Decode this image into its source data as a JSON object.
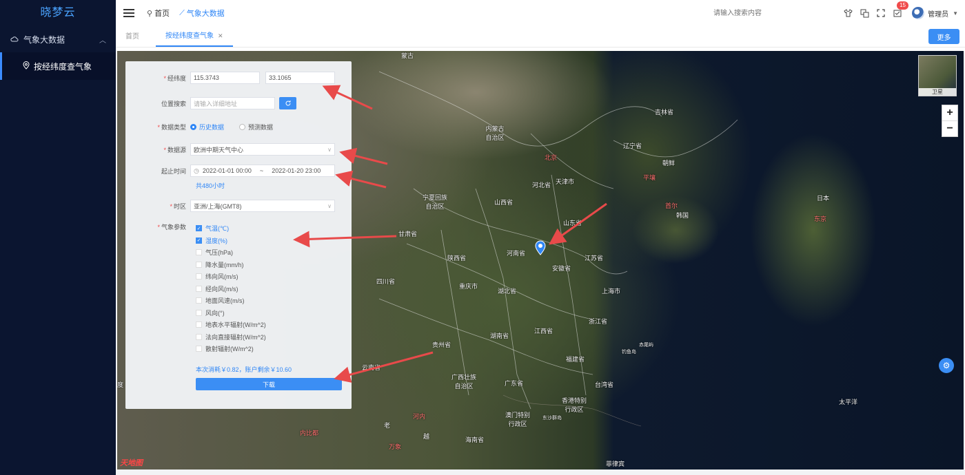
{
  "sidebar": {
    "logo": "晓梦云",
    "group_label": "气象大数据",
    "active_item": "按经纬度查气象"
  },
  "header": {
    "crumb_home": "首页",
    "crumb_current": "气象大数据",
    "search_placeholder": "请输入搜索内容",
    "notification_count": "15",
    "user_name": "管理员"
  },
  "tabs": {
    "home": "首页",
    "active": "按经纬度查气象",
    "more_button": "更多"
  },
  "form": {
    "latlng_label": "经纬度",
    "lng_value": "115.3743",
    "lat_value": "33.1065",
    "location_label": "位置搜索",
    "location_placeholder": "请输入详细地址",
    "datatype_label": "数据类型",
    "datatype_options": [
      "历史数据",
      "预测数据"
    ],
    "datatype_selected": "历史数据",
    "source_label": "数据源",
    "source_value": "欧洲中期天气中心",
    "time_label": "起止时间",
    "time_start": "2022-01-01 00:00",
    "time_sep": "~",
    "time_end": "2022-01-20 23:00",
    "total_hours": "共480小时",
    "tz_label": "时区",
    "tz_value": "亚洲/上海(GMT8)",
    "params_label": "气象参数",
    "params": [
      {
        "label": "气温(℃)",
        "checked": true
      },
      {
        "label": "湿度(%)",
        "checked": true
      },
      {
        "label": "气压(hPa)",
        "checked": false
      },
      {
        "label": "降水量(mm/h)",
        "checked": false
      },
      {
        "label": "纬向风(m/s)",
        "checked": false
      },
      {
        "label": "经向风(m/s)",
        "checked": false
      },
      {
        "label": "地面风速(m/s)",
        "checked": false
      },
      {
        "label": "风向(°)",
        "checked": false
      },
      {
        "label": "地表水平辐射(W/m^2)",
        "checked": false
      },
      {
        "label": "法向直接辐射(W/m^2)",
        "checked": false
      },
      {
        "label": "散射辐射(W/m^2)",
        "checked": false
      }
    ],
    "cost_text": "本次消耗￥0.82，账户剩余￥10.60",
    "download_button": "下载"
  },
  "map": {
    "layer_label": "卫星",
    "watermark": "天地图",
    "labels": [
      {
        "text": "蒙古",
        "red": false
      },
      {
        "text": "内蒙古自治区",
        "red": false
      },
      {
        "text": "北京",
        "red": true
      },
      {
        "text": "天津市",
        "red": false
      },
      {
        "text": "河北省",
        "red": false
      },
      {
        "text": "山西省",
        "red": false
      },
      {
        "text": "宁夏回族自治区",
        "red": false
      },
      {
        "text": "甘肃省",
        "red": false
      },
      {
        "text": "陕西省",
        "red": false
      },
      {
        "text": "河南省",
        "red": false
      },
      {
        "text": "山东省",
        "red": false
      },
      {
        "text": "江苏省",
        "red": false
      },
      {
        "text": "安徽省",
        "red": false
      },
      {
        "text": "上海市",
        "red": false
      },
      {
        "text": "四川省",
        "red": false
      },
      {
        "text": "重庆市",
        "red": false
      },
      {
        "text": "湖北省",
        "red": false
      },
      {
        "text": "湖南省",
        "red": false
      },
      {
        "text": "江西省",
        "red": false
      },
      {
        "text": "浙江省",
        "red": false
      },
      {
        "text": "福建省",
        "red": false
      },
      {
        "text": "贵州省",
        "red": false
      },
      {
        "text": "云南省",
        "red": false
      },
      {
        "text": "广西壮族自治区",
        "red": false
      },
      {
        "text": "广东省",
        "red": false
      },
      {
        "text": "台湾省",
        "red": false
      },
      {
        "text": "海南省",
        "red": false
      },
      {
        "text": "香港特别行政区",
        "red": false
      },
      {
        "text": "澳门特别行政区",
        "red": false
      },
      {
        "text": "东沙群岛",
        "red": false
      },
      {
        "text": "赤尾屿",
        "red": false
      },
      {
        "text": "钓鱼岛",
        "red": false
      },
      {
        "text": "吉林省",
        "red": false
      },
      {
        "text": "辽宁省",
        "red": false
      },
      {
        "text": "朝鲜",
        "red": false
      },
      {
        "text": "平壤",
        "red": true
      },
      {
        "text": "首尔",
        "red": true
      },
      {
        "text": "韩国",
        "red": false
      },
      {
        "text": "日本",
        "red": false
      },
      {
        "text": "东京",
        "red": true
      },
      {
        "text": "河内",
        "red": true
      },
      {
        "text": "老",
        "red": false
      },
      {
        "text": "万象",
        "red": true
      },
      {
        "text": "内比都",
        "red": true
      },
      {
        "text": "越",
        "red": false
      },
      {
        "text": "菲律宾",
        "red": false
      },
      {
        "text": "太平洋",
        "red": false
      },
      {
        "text": "度",
        "red": false
      }
    ]
  }
}
